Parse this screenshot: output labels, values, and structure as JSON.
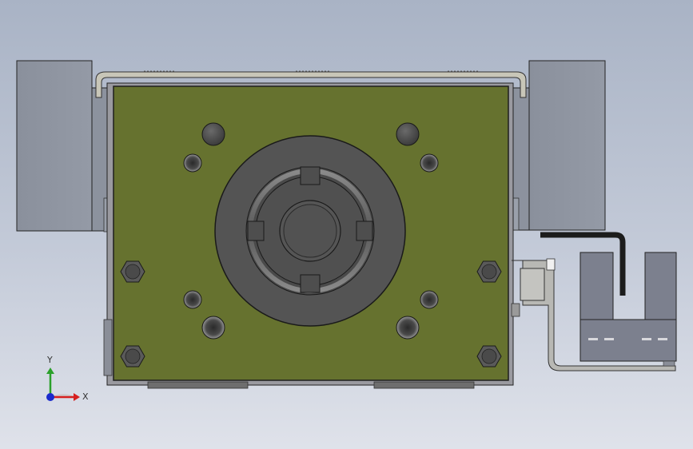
{
  "viewport": {
    "background_top": "#a9b3c5",
    "background_bottom": "#dfe2ea"
  },
  "model": {
    "plate_color": "#66722f",
    "housing_color": "#8c93a1",
    "bore_color": "#545454"
  },
  "triad": {
    "x_label": "X",
    "y_label": "Y",
    "x_color": "#d62020",
    "y_color": "#2aa02a",
    "z_color": "#1a2acc"
  }
}
